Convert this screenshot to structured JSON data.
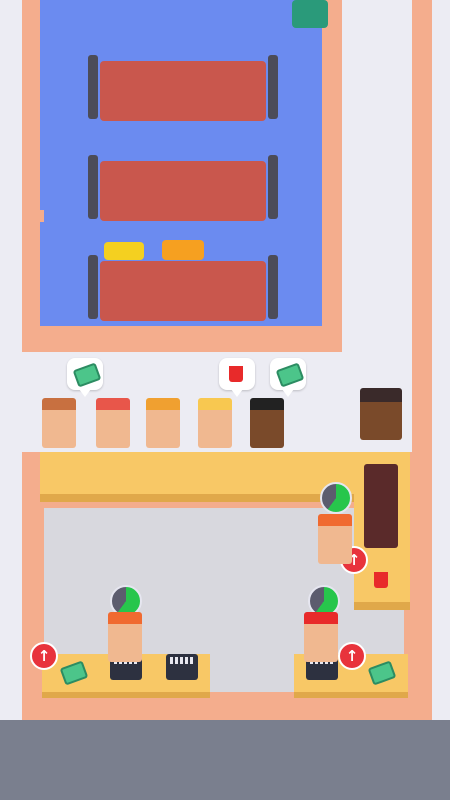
{
  "scene": "cinema-lobby",
  "colors": {
    "background": "#ececf3",
    "wall": "#f4ad8d",
    "hall_floor": "#6b8bf0",
    "lobby_floor": "#d8d8de",
    "counter": "#f8c866",
    "sofa": "#c9574d",
    "upgrade": "#e8333c",
    "timer_fill": "#27c64c"
  },
  "queue": {
    "customers": [
      {
        "hair": "#c87040",
        "skin": "#f0b890",
        "shirt": "#f0a878",
        "request": "ticket-icon"
      },
      {
        "hair": "#e8564a",
        "skin": "#f0b890",
        "shirt": "#3a8ad8",
        "request": null
      },
      {
        "hair": "#f0a030",
        "skin": "#f0b890",
        "shirt": "#4ab8e0",
        "request": null
      },
      {
        "hair": "#f8c850",
        "skin": "#f0b890",
        "shirt": "#e8564a",
        "request": "drink-icon"
      },
      {
        "hair": "#222222",
        "skin": "#7a4a2a",
        "shirt": "#2aa04a",
        "request": "ticket-icon"
      }
    ]
  },
  "stations": {
    "left_register": {
      "upgrade": "arrow-up-icon",
      "item": "ticket-icon"
    },
    "right_register": {
      "upgrade": "arrow-up-icon",
      "item": "ticket-icon"
    },
    "snack_bar": {
      "upgrade": "arrow-up-icon",
      "item": "drink-icon"
    }
  },
  "workers": [
    {
      "role": "cashier-left",
      "progress": 0.65
    },
    {
      "role": "cashier-right",
      "progress": 0.5
    },
    {
      "role": "snack-server",
      "progress": 0.6
    }
  ]
}
